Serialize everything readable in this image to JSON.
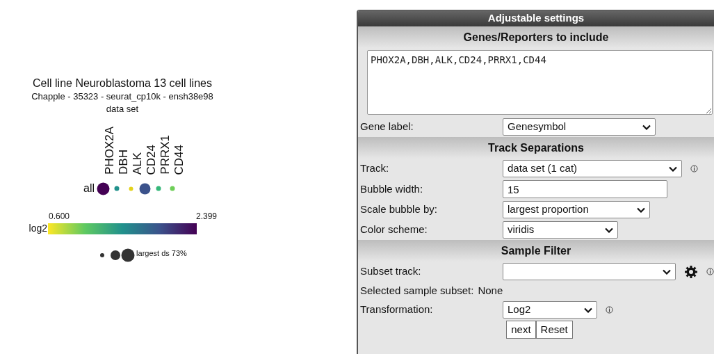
{
  "plot": {
    "title": "Cell line Neuroblastoma 13 cell lines",
    "subtitle": "Chapple - 35323 - seurat_cp10k - ensh38e98",
    "caption": "data set",
    "row_label": "all",
    "genes": [
      {
        "name": "PHOX2A",
        "color": "#440154"
      },
      {
        "name": "DBH",
        "color": "#21918c"
      },
      {
        "name": "ALK",
        "color": "#e3d21b"
      },
      {
        "name": "CD24",
        "color": "#3b528b"
      },
      {
        "name": "PRRX1",
        "color": "#35b779"
      },
      {
        "name": "CD44",
        "color": "#6ece58"
      }
    ],
    "legend": {
      "min": "0.600",
      "max": "2.399",
      "label": "log2",
      "size_label": "largest ds 73%"
    }
  },
  "panel": {
    "title": "Adjustable settings",
    "sections": [
      {
        "heading": "Genes/Reporters to include",
        "rows": [
          {
            "kind": "textarea",
            "value": "PHOX2A,DBH,ALK,CD24,PRRX1,CD44"
          },
          {
            "kind": "select",
            "label": "Gene label:",
            "value": "Genesymbol"
          }
        ]
      },
      {
        "heading": "Track Separations",
        "rows": [
          {
            "kind": "select",
            "label": "Track:",
            "value": "data set (1 cat)",
            "info": true
          },
          {
            "kind": "input",
            "label": "Bubble width:",
            "value": "15"
          },
          {
            "kind": "select",
            "label": "Scale bubble by:",
            "value": "largest proportion"
          },
          {
            "kind": "select",
            "label": "Color scheme:",
            "value": "viridis"
          }
        ]
      },
      {
        "heading": "Sample Filter",
        "rows": [
          {
            "kind": "select",
            "label": "Subset track:",
            "value": "",
            "info": true,
            "gear": true
          },
          {
            "kind": "text",
            "label": "Selected sample subset:",
            "value": "None"
          },
          {
            "kind": "select",
            "label": "Transformation:",
            "value": "Log2",
            "info": true
          }
        ]
      }
    ],
    "buttons": [
      "next",
      "Reset"
    ]
  }
}
